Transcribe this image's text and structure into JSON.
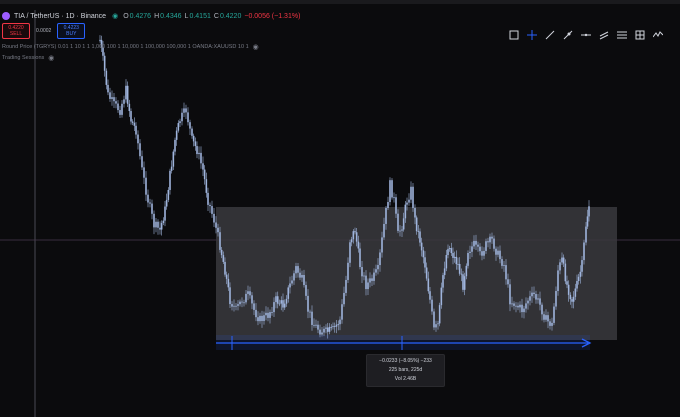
{
  "symbol": {
    "title": "TIA / TetherUS · 1D · Binance",
    "ohlc": [
      {
        "label": "O",
        "value": "0.4276"
      },
      {
        "label": "H",
        "value": "0.4346"
      },
      {
        "label": "L",
        "value": "0.4151"
      },
      {
        "label": "C",
        "value": "0.4220"
      }
    ],
    "change": "−0.0056 (−1.31%)"
  },
  "trade": {
    "sell_price": "0.4220",
    "sell_label": "SELL",
    "spread": "0.0002",
    "buy_price": "0.4223",
    "buy_label": "BUY"
  },
  "indicators": [
    {
      "name": "Round Price (TGRYS) 0.01 1 10 1 1 1,000 100 1 10,000 1 100,000 100,000 1 OANDA:XAUUSD 10 1"
    },
    {
      "name": "Trading Sessions"
    }
  ],
  "toolbar": {
    "tools": [
      {
        "icon": "rectangle-icon"
      },
      {
        "icon": "crosshair-icon"
      },
      {
        "icon": "trend-line-icon"
      },
      {
        "icon": "ray-icon"
      },
      {
        "icon": "horizontal-line-icon"
      },
      {
        "icon": "parallel-channel-icon"
      },
      {
        "icon": "fib-retracement-icon"
      },
      {
        "icon": "grid-icon"
      },
      {
        "icon": "wave-icon"
      }
    ]
  },
  "measure": {
    "change": "−0.0233 (−8.05%) −233",
    "bars": "225 bars, 225d",
    "volume": "Vol 2.46B"
  },
  "colors": {
    "background": "#0b0b0d",
    "candle": "#9fb4dc",
    "range_box": "#3a3a3e",
    "measure_arrow": "#2962ff",
    "crosshair": "#4b3a52",
    "up": "#26a69a",
    "down": "#f23645"
  }
}
